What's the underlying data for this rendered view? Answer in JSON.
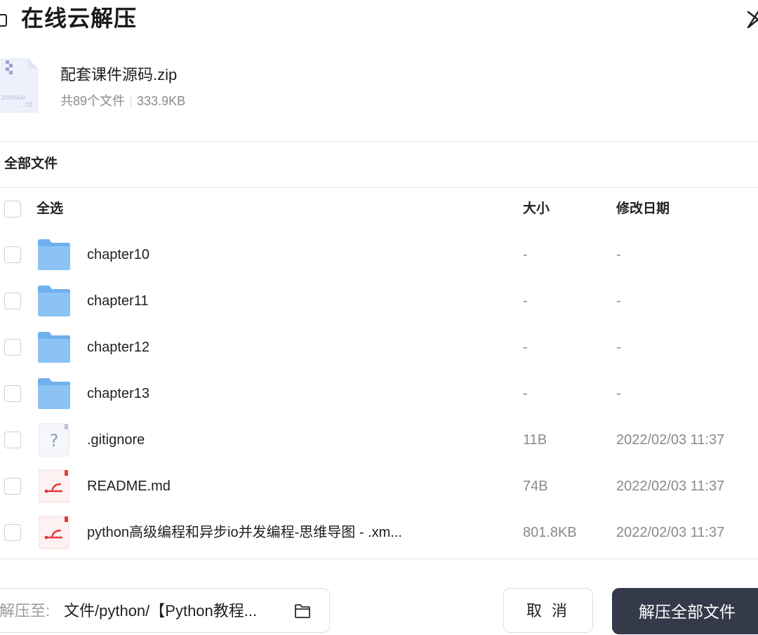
{
  "header": {
    "title": "在线云解压"
  },
  "archive": {
    "name": "配套课件源码.zip",
    "file_count": "共89个文件",
    "size": "333.9KB",
    "icon_text_top": "ZIP/RAR/",
    "icon_text_bottom": "...7Z"
  },
  "breadcrumb": "全部文件",
  "table": {
    "select_all_label": "全选",
    "col_size": "大小",
    "col_date": "修改日期",
    "rows": [
      {
        "name": "chapter10",
        "type": "folder",
        "size": "-",
        "date": "-"
      },
      {
        "name": "chapter11",
        "type": "folder",
        "size": "-",
        "date": "-"
      },
      {
        "name": "chapter12",
        "type": "folder",
        "size": "-",
        "date": "-"
      },
      {
        "name": "chapter13",
        "type": "folder",
        "size": "-",
        "date": "-"
      },
      {
        "name": ".gitignore",
        "type": "unknown",
        "size": "11B",
        "date": "2022/02/03 11:37",
        "icon_glyph": "?"
      },
      {
        "name": "README.md",
        "type": "mindmap",
        "size": "74B",
        "date": "2022/02/03 11:37"
      },
      {
        "name": "python高级编程和异步io并发编程-思维导图 - .xm...",
        "type": "mindmap",
        "size": "801.8KB",
        "date": "2022/02/03 11:37"
      }
    ]
  },
  "footer": {
    "path_label": "解压至:",
    "path_value": "文件/python/【Python教程...",
    "cancel_label": "取 消",
    "extract_label": "解压全部文件"
  },
  "colors": {
    "primary_button": "#343a4a",
    "folder": "#7ab8f0",
    "mindmap_red": "#e23b3b"
  }
}
